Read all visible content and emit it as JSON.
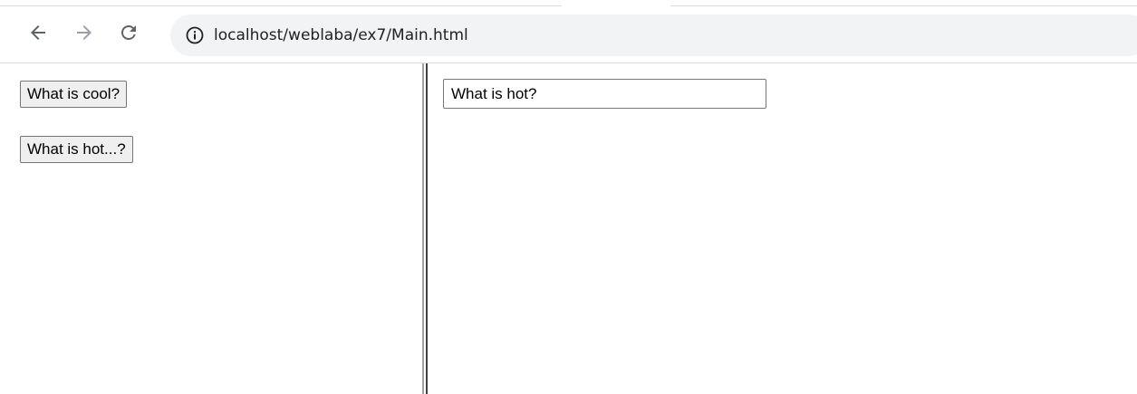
{
  "browser": {
    "address_bar": {
      "url": "localhost/weblaba/ex7/Main.html"
    },
    "icons": {
      "back": "arrow-left",
      "forward": "arrow-right",
      "reload": "circular-arrow",
      "site_info": "info-circle"
    }
  },
  "left_frame": {
    "buttons": [
      {
        "label": "What is cool?"
      },
      {
        "label": "What is hot...?"
      }
    ]
  },
  "right_frame": {
    "answer_field": {
      "value": "What is hot?"
    }
  },
  "colors": {
    "toolbar_background": "#ffffff",
    "omnibox_background": "#f1f3f4",
    "icon_dark": "#5f6368",
    "icon_disabled": "#9aa0a6",
    "button_background": "#efefef",
    "border": "#767676"
  }
}
